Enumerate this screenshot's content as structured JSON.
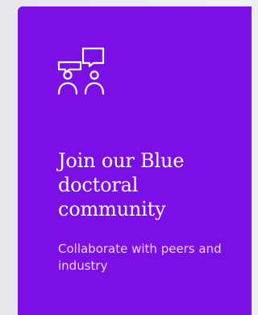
{
  "card": {
    "icon": "people-chat-icon",
    "title": "Join our Blue doctoral community",
    "description": "Collaborate with peers and industry",
    "background_color": "#7b0fe6"
  }
}
